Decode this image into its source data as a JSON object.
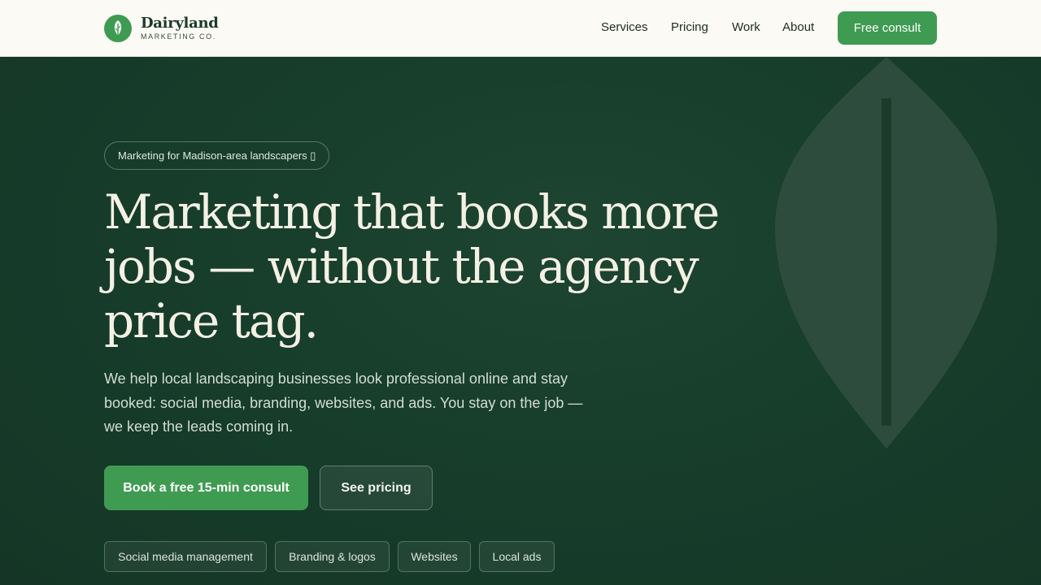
{
  "header": {
    "brand_name": "Dairyland",
    "brand_sub": "MARKETING CO.",
    "nav": [
      {
        "label": "Services"
      },
      {
        "label": "Pricing"
      },
      {
        "label": "Work"
      },
      {
        "label": "About"
      }
    ],
    "cta_label": "Free consult"
  },
  "hero": {
    "pill": "Marketing for Madison-area landscapers ▯",
    "headline": "Marketing that books more jobs — without the agency price tag.",
    "subtext": "We help local landscaping businesses look professional online and stay booked: social media, branding, websites, and ads. You stay on the job — we keep the leads coming in.",
    "primary_button": "Book a free 15-min consult",
    "secondary_button": "See pricing",
    "tags": [
      "Social media management",
      "Branding & logos",
      "Websites",
      "Local ads"
    ]
  },
  "icons": {
    "brand_logo": "leaf-icon",
    "hero_decoration": "leaf-icon"
  },
  "colors": {
    "accent": "#3f9b52",
    "hero_bg": "#173a2b",
    "header_bg": "#fbfaf5",
    "headline_text": "#f4f0e4"
  }
}
